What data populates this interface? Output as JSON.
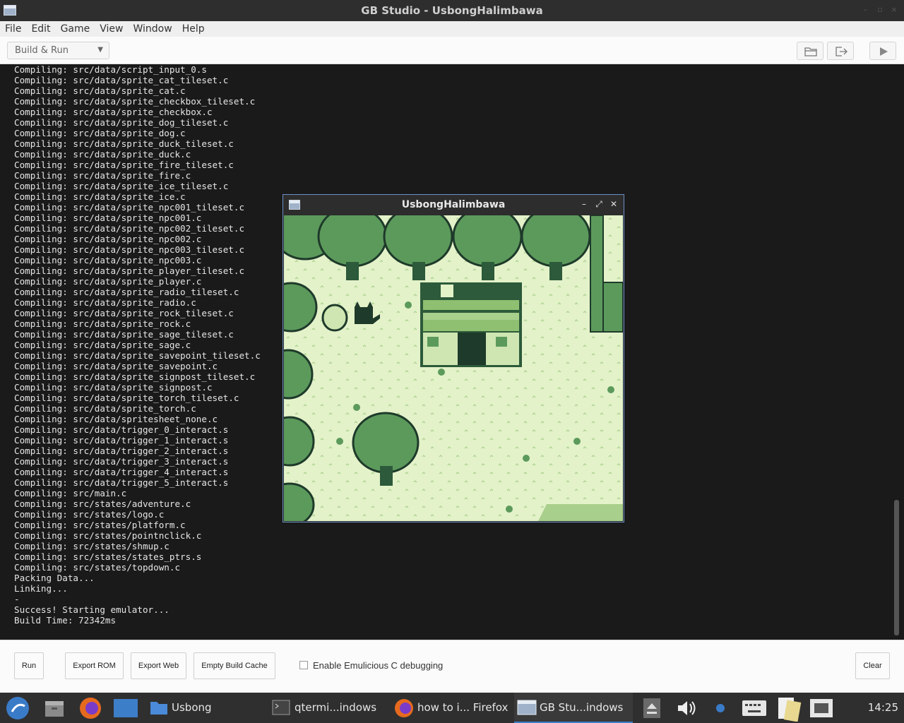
{
  "window": {
    "title": "GB Studio - UsbongHalimbawa"
  },
  "menu": [
    "File",
    "Edit",
    "Game",
    "View",
    "Window",
    "Help"
  ],
  "toolbar": {
    "build_select": "Build & Run"
  },
  "console": {
    "lines": [
      "Compiling: src/data/script_input_0.s",
      "Compiling: src/data/sprite_cat_tileset.c",
      "Compiling: src/data/sprite_cat.c",
      "Compiling: src/data/sprite_checkbox_tileset.c",
      "Compiling: src/data/sprite_checkbox.c",
      "Compiling: src/data/sprite_dog_tileset.c",
      "Compiling: src/data/sprite_dog.c",
      "Compiling: src/data/sprite_duck_tileset.c",
      "Compiling: src/data/sprite_duck.c",
      "Compiling: src/data/sprite_fire_tileset.c",
      "Compiling: src/data/sprite_fire.c",
      "Compiling: src/data/sprite_ice_tileset.c",
      "Compiling: src/data/sprite_ice.c",
      "Compiling: src/data/sprite_npc001_tileset.c",
      "Compiling: src/data/sprite_npc001.c",
      "Compiling: src/data/sprite_npc002_tileset.c",
      "Compiling: src/data/sprite_npc002.c",
      "Compiling: src/data/sprite_npc003_tileset.c",
      "Compiling: src/data/sprite_npc003.c",
      "Compiling: src/data/sprite_player_tileset.c",
      "Compiling: src/data/sprite_player.c",
      "Compiling: src/data/sprite_radio_tileset.c",
      "Compiling: src/data/sprite_radio.c",
      "Compiling: src/data/sprite_rock_tileset.c",
      "Compiling: src/data/sprite_rock.c",
      "Compiling: src/data/sprite_sage_tileset.c",
      "Compiling: src/data/sprite_sage.c",
      "Compiling: src/data/sprite_savepoint_tileset.c",
      "Compiling: src/data/sprite_savepoint.c",
      "Compiling: src/data/sprite_signpost_tileset.c",
      "Compiling: src/data/sprite_signpost.c",
      "Compiling: src/data/sprite_torch_tileset.c",
      "Compiling: src/data/sprite_torch.c",
      "Compiling: src/data/spritesheet_none.c",
      "Compiling: src/data/trigger_0_interact.s",
      "Compiling: src/data/trigger_1_interact.s",
      "Compiling: src/data/trigger_2_interact.s",
      "Compiling: src/data/trigger_3_interact.s",
      "Compiling: src/data/trigger_4_interact.s",
      "Compiling: src/data/trigger_5_interact.s",
      "Compiling: src/main.c",
      "Compiling: src/states/adventure.c",
      "Compiling: src/states/logo.c",
      "Compiling: src/states/platform.c",
      "Compiling: src/states/pointnclick.c",
      "Compiling: src/states/shmup.c",
      "Compiling: src/states/states_ptrs.s",
      "Compiling: src/states/topdown.c",
      "Packing Data...",
      "Linking...",
      "-",
      "Success! Starting emulator...",
      "Build Time: 72342ms"
    ]
  },
  "emulator": {
    "title": "UsbongHalimbawa"
  },
  "bottom": {
    "run": "Run",
    "export_rom": "Export ROM",
    "export_web": "Export Web",
    "empty_cache": "Empty Build Cache",
    "debug_label": "Enable Emulicious C debugging",
    "debug_checked": false,
    "clear": "Clear"
  },
  "taskbar": {
    "folder_label": "Usbong",
    "terminal_label": "qtermi...indows",
    "firefox_label": "how to i... Firefox",
    "gbstudio_label": "GB Stu...indows",
    "clock": "14:25"
  },
  "colors": {
    "gb_light": "#e3f2c9",
    "gb_mid": "#8fbf70",
    "gb_dark": "#2c5a3a",
    "gb_darkest": "#1e3a2a",
    "accent": "#3d7ec8"
  }
}
